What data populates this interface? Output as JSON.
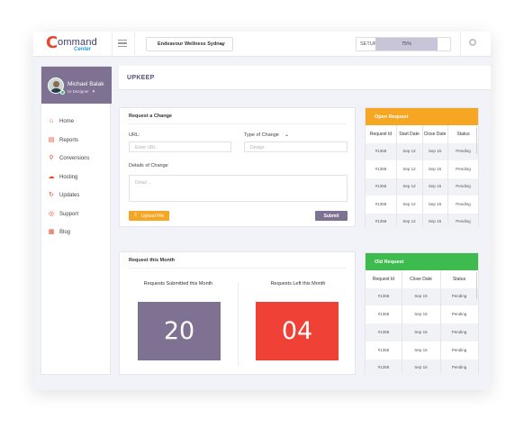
{
  "app": {
    "logo_text": "ommand",
    "logo_sub": "Center",
    "location": "Endeavour Wellness Sydney",
    "setup_label": "SETUP",
    "setup_progress": "75%",
    "setup_progress_fraction": 0.75
  },
  "user": {
    "name": "Michael Balak",
    "role": "UI Designer"
  },
  "sidebar": {
    "items": [
      {
        "label": "Home",
        "icon": "home-icon",
        "glyph": "⌂"
      },
      {
        "label": "Reports",
        "icon": "reports-icon",
        "glyph": "▤"
      },
      {
        "label": "Conversions",
        "icon": "conversions-icon",
        "glyph": "⚲"
      },
      {
        "label": "Hosting",
        "icon": "hosting-icon",
        "glyph": "☁"
      },
      {
        "label": "Updates",
        "icon": "updates-icon",
        "glyph": "↻"
      },
      {
        "label": "Support",
        "icon": "support-icon",
        "glyph": "◎"
      },
      {
        "label": "Blog",
        "icon": "blog-icon",
        "glyph": "▦"
      }
    ]
  },
  "page": {
    "title": "UPKEEP"
  },
  "request_form": {
    "title": "Request a Change",
    "url_label": "URL:",
    "url_placeholder": "Enter URL",
    "type_label": "Type of Change",
    "type_value": "Design",
    "details_label": "Details of Change",
    "details_placeholder": "Detail ...",
    "upload_label": "Upload File",
    "submit_label": "Submit"
  },
  "month": {
    "title": "Request this Month",
    "submitted_label": "Requests Submitted this Month",
    "submitted_value": "20",
    "left_label": "Requests Left this Month",
    "left_value": "04"
  },
  "open_request": {
    "title": "Open Request",
    "columns": [
      "Request Id",
      "Start Date",
      "Close Date",
      "Status"
    ],
    "rows": [
      [
        "#1358",
        "Sep 12",
        "Sep 15",
        "Pending"
      ],
      [
        "#1358",
        "Sep 12",
        "Sep 15",
        "Pending"
      ],
      [
        "#1358",
        "Sep 12",
        "Sep 15",
        "Pending"
      ],
      [
        "#1358",
        "Sep 12",
        "Sep 15",
        "Pending"
      ],
      [
        "#1358",
        "Sep 12",
        "Sep 15",
        "Pending"
      ]
    ]
  },
  "old_request": {
    "title": "Old Request",
    "columns": [
      "Request Id",
      "Close Date",
      "Status"
    ],
    "rows": [
      [
        "#1358",
        "Sep 15",
        "Pending"
      ],
      [
        "#1358",
        "Sep 15",
        "Pending"
      ],
      [
        "#1358",
        "Sep 15",
        "Pending"
      ],
      [
        "#1358",
        "Sep 15",
        "Pending"
      ],
      [
        "#1358",
        "Sep 15",
        "Pending"
      ]
    ]
  },
  "colors": {
    "accent_purple": "#7e7191",
    "orange": "#f5a623",
    "green": "#3dbb4e",
    "red": "#ef4136",
    "logo_red": "#e5482d"
  }
}
